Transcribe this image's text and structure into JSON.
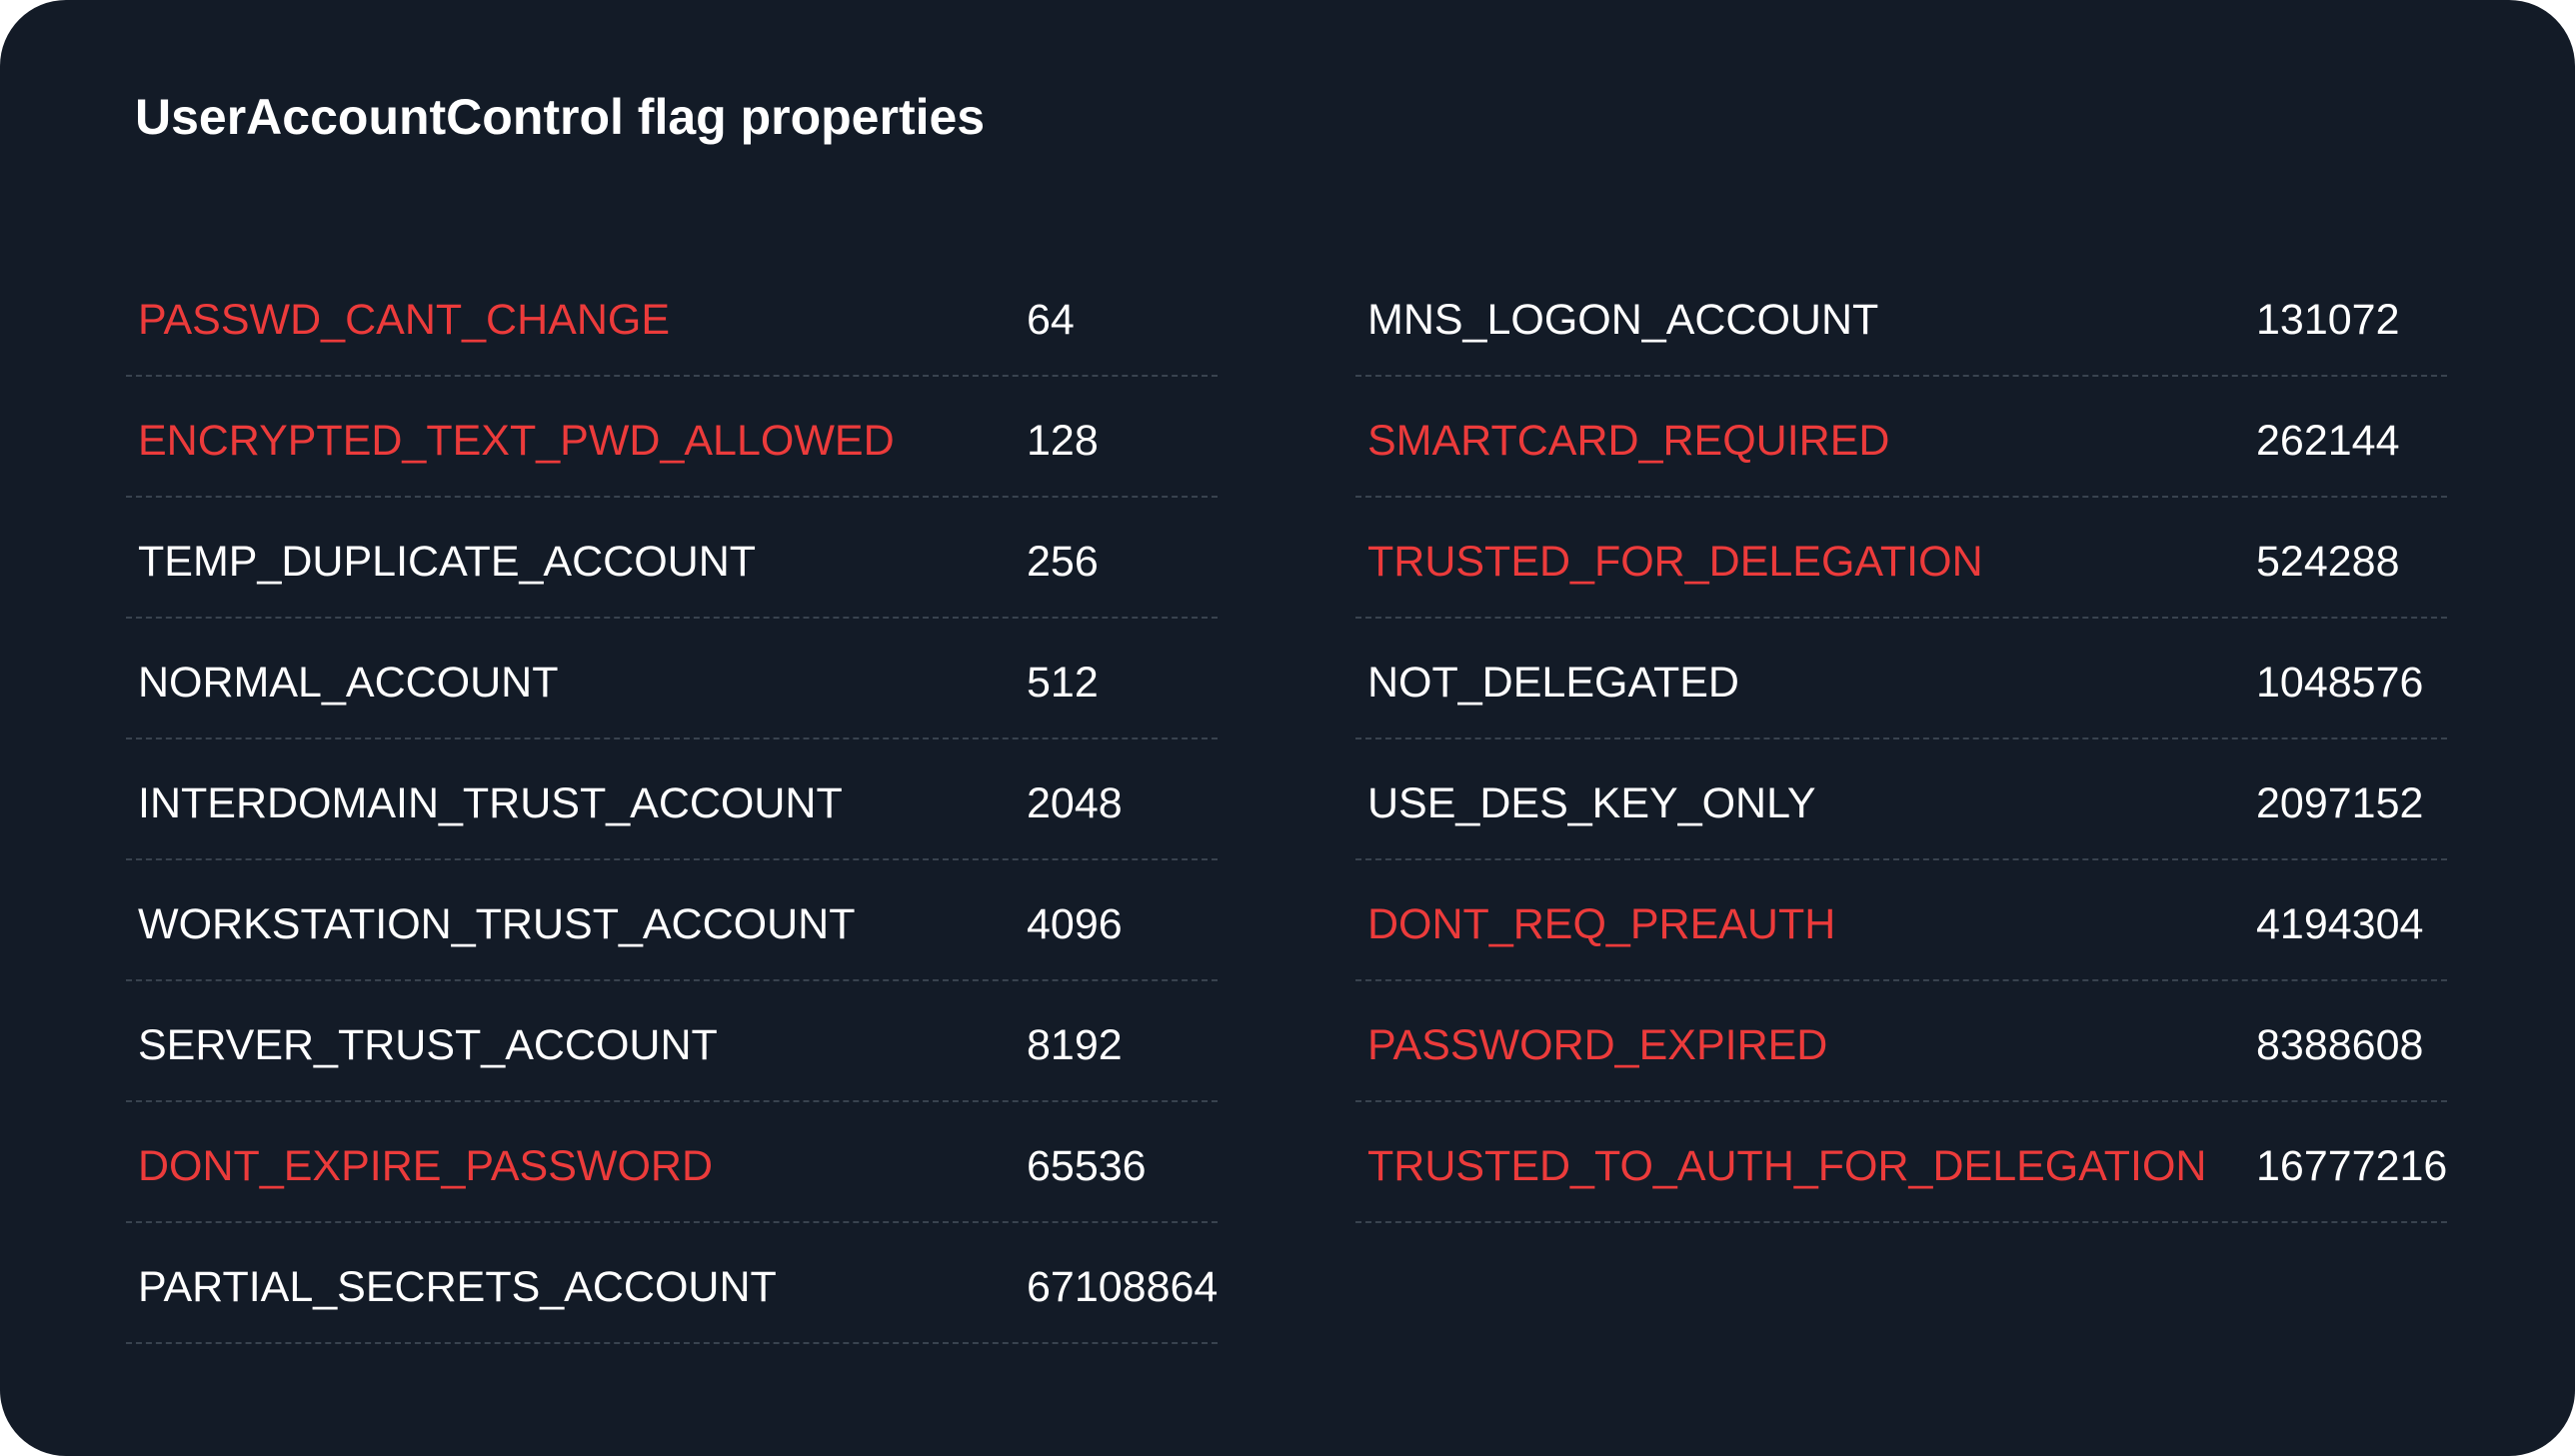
{
  "title": "UserAccountControl flag properties",
  "colors": {
    "background": "#131b27",
    "highlight": "#ec3b3b",
    "normal": "#ffffff",
    "divider": "#39434f"
  },
  "columns": [
    {
      "rows": [
        {
          "name": "PASSWD_CANT_CHANGE",
          "value": "64",
          "highlighted": true
        },
        {
          "name": "ENCRYPTED_TEXT_PWD_ALLOWED",
          "value": "128",
          "highlighted": true
        },
        {
          "name": "TEMP_DUPLICATE_ACCOUNT",
          "value": "256",
          "highlighted": false
        },
        {
          "name": "NORMAL_ACCOUNT",
          "value": "512",
          "highlighted": false
        },
        {
          "name": "INTERDOMAIN_TRUST_ACCOUNT",
          "value": "2048",
          "highlighted": false
        },
        {
          "name": "WORKSTATION_TRUST_ACCOUNT",
          "value": "4096",
          "highlighted": false
        },
        {
          "name": "SERVER_TRUST_ACCOUNT",
          "value": "8192",
          "highlighted": false
        },
        {
          "name": "DONT_EXPIRE_PASSWORD",
          "value": "65536",
          "highlighted": true
        },
        {
          "name": "PARTIAL_SECRETS_ACCOUNT",
          "value": "67108864",
          "highlighted": false
        }
      ]
    },
    {
      "rows": [
        {
          "name": "MNS_LOGON_ACCOUNT",
          "value": "131072",
          "highlighted": false
        },
        {
          "name": "SMARTCARD_REQUIRED",
          "value": "262144",
          "highlighted": true
        },
        {
          "name": "TRUSTED_FOR_DELEGATION",
          "value": "524288",
          "highlighted": true
        },
        {
          "name": "NOT_DELEGATED",
          "value": "1048576",
          "highlighted": false
        },
        {
          "name": "USE_DES_KEY_ONLY",
          "value": "2097152",
          "highlighted": false
        },
        {
          "name": "DONT_REQ_PREAUTH",
          "value": "4194304",
          "highlighted": true
        },
        {
          "name": "PASSWORD_EXPIRED",
          "value": "8388608",
          "highlighted": true
        },
        {
          "name": "TRUSTED_TO_AUTH_FOR_DELEGATION",
          "value": "16777216",
          "highlighted": true
        }
      ]
    }
  ]
}
